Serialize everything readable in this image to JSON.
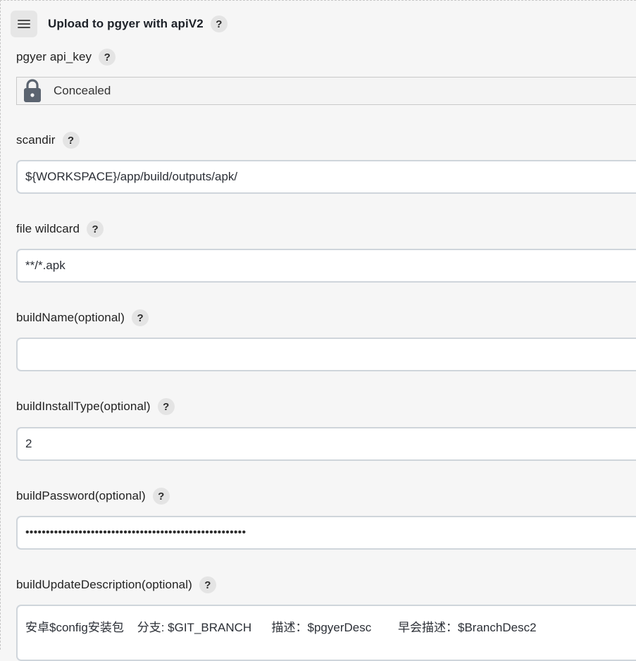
{
  "section": {
    "title": "Upload to pgyer with apiV2",
    "help": "?"
  },
  "fields": {
    "api_key": {
      "label": "pgyer api_key",
      "help": "?",
      "value": "Concealed"
    },
    "scandir": {
      "label": "scandir",
      "help": "?",
      "value": "${WORKSPACE}/app/build/outputs/apk/"
    },
    "file_wildcard": {
      "label": "file wildcard",
      "help": "?",
      "value": "**/*.apk"
    },
    "build_name": {
      "label": "buildName(optional)",
      "help": "?",
      "value": ""
    },
    "build_install_type": {
      "label": "buildInstallType(optional)",
      "help": "?",
      "value": "2"
    },
    "build_password": {
      "label": "buildPassword(optional)",
      "help": "?",
      "value": "••••••••••••••••••••••••••••••••••••••••••••••••••••••"
    },
    "build_update_description": {
      "label": "buildUpdateDescription(optional)",
      "help": "?",
      "value": "安卓$config安装包    分支: $GIT_BRANCH      描述：$pgyerDesc        早会描述：$BranchDesc2"
    }
  },
  "icons": {
    "drag_handle": "menu-icon",
    "lock": "lock-icon"
  },
  "colors": {
    "background": "#f6f6f6",
    "input_border": "#cfd5db",
    "help_bg": "#e4e4e4",
    "lock": "#5b6470"
  }
}
